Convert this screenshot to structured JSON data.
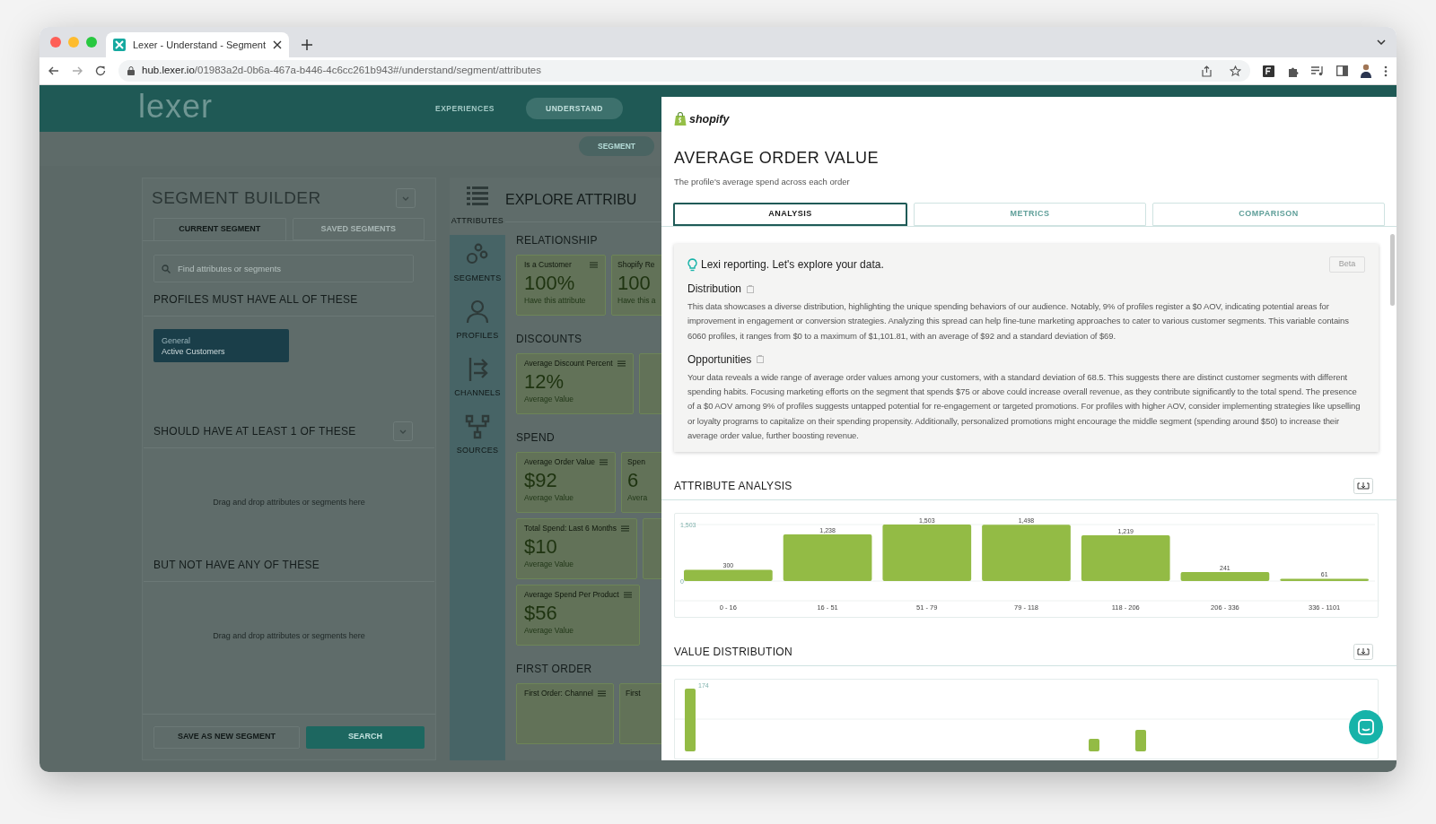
{
  "browser": {
    "tab_title": "Lexer - Understand - Segment",
    "url_host": "hub.lexer.io",
    "url_path": "/01983a2d-0b6a-467a-b446-4c6cc261b943#/understand/segment/attributes"
  },
  "app_header": {
    "logo": "lexer",
    "nav": [
      {
        "label": "EXPERIENCES",
        "selected": false
      },
      {
        "label": "UNDERSTAND",
        "selected": true
      }
    ],
    "subnav": [
      {
        "label": "SEGMENT",
        "selected": true
      }
    ]
  },
  "segment_builder": {
    "title": "SEGMENT BUILDER",
    "tabs": [
      {
        "label": "CURRENT SEGMENT",
        "selected": true
      },
      {
        "label": "SAVED SEGMENTS",
        "selected": false
      }
    ],
    "search": {
      "placeholder": "Find attributes or segments"
    },
    "sections": [
      {
        "title": "PROFILES MUST HAVE ALL OF THESE",
        "dropdown": false,
        "chips": [
          {
            "category": "General",
            "name": "Active Customers"
          }
        ]
      },
      {
        "title": "SHOULD HAVE AT LEAST 1 OF THESE",
        "dropdown": true,
        "hint": "Drag and drop attributes or segments here"
      },
      {
        "title": "BUT NOT HAVE ANY OF THESE",
        "dropdown": false,
        "hint": "Drag and drop attributes or segments here"
      }
    ],
    "buttons": [
      {
        "label": "SAVE AS NEW SEGMENT",
        "kind": "outline"
      },
      {
        "label": "SEARCH",
        "kind": "primary"
      }
    ]
  },
  "explore_nav": [
    {
      "label": "ATTRIBUTES",
      "kind": "list",
      "selected": true
    },
    {
      "label": "SEGMENTS",
      "kind": "circles",
      "selected": false
    },
    {
      "label": "PROFILES",
      "kind": "person",
      "selected": false
    },
    {
      "label": "CHANNELS",
      "kind": "arrows",
      "selected": false
    },
    {
      "label": "SOURCES",
      "kind": "network",
      "selected": false
    }
  ],
  "explore": {
    "title": "EXPLORE ATTRIBU",
    "groups": [
      {
        "title": "RELATIONSHIP",
        "rows": [
          [
            {
              "title": "Is a Customer",
              "value": "100%",
              "caption": "Have this attribute"
            },
            {
              "title": "Shopify Re",
              "value": "100",
              "caption": "Have this a"
            }
          ]
        ]
      },
      {
        "title": "DISCOUNTS",
        "rows": [
          [
            {
              "title": "Average Discount Percent",
              "value": "12%",
              "caption": "Average Value"
            },
            {}
          ]
        ]
      },
      {
        "title": "SPEND",
        "rows": [
          [
            {
              "title": "Average Order Value",
              "value": "$92",
              "caption": "Average Value"
            },
            {
              "title": "Spen",
              "value": "6",
              "caption": "Avera"
            }
          ],
          [
            {
              "title": "Total Spend: Last 6 Months",
              "value": "$10",
              "caption": "Average Value"
            },
            {}
          ],
          [
            {
              "title": "Average Spend Per Product",
              "value": "$56",
              "caption": "Average Value"
            }
          ]
        ]
      },
      {
        "title": "FIRST ORDER",
        "rows": [
          [
            {
              "title": "First Order: Channel"
            },
            {
              "title": "First"
            }
          ]
        ]
      }
    ]
  },
  "detail": {
    "source": "shopify",
    "title": "AVERAGE ORDER VALUE",
    "subtitle": "The profile's average spend across each order",
    "tabs": [
      {
        "label": "ANALYSIS",
        "selected": true
      },
      {
        "label": "METRICS",
        "selected": false
      },
      {
        "label": "COMPARISON",
        "selected": false
      }
    ],
    "lexi": {
      "heading": "Lexi reporting. Let's explore your data.",
      "badge": "Beta",
      "sections": [
        {
          "title": "Distribution",
          "text": "This data showcases a diverse distribution, highlighting the unique spending behaviors of our audience. Notably, 9% of profiles register a $0 AOV, indicating potential areas for improvement in engagement or conversion strategies. Analyzing this spread can help fine-tune marketing approaches to cater to various customer segments. This variable contains 6060 profiles, it ranges from $0 to a maximum of $1,101.81, with an average of $92 and a standard deviation of $69."
        },
        {
          "title": "Opportunities",
          "text": "Your data reveals a wide range of average order values among your customers, with a standard deviation of 68.5. This suggests there are distinct customer segments with different spending habits. Focusing marketing efforts on the segment that spends $75 or above could increase overall revenue, as they contribute significantly to the total spend. The presence of a $0 AOV among 9% of profiles suggests untapped potential for re-engagement or targeted promotions. For profiles with higher AOV, consider implementing strategies like upselling or loyalty programs to capitalize on their spending propensity. Additionally, personalized promotions might encourage the middle segment (spending around $50) to increase their average order value, further boosting revenue."
        }
      ]
    },
    "attribute_analysis": {
      "title": "ATTRIBUTE ANALYSIS",
      "chart_data": {
        "type": "bar",
        "categories": [
          "0 - 16",
          "16 - 51",
          "51 - 79",
          "79 - 118",
          "118 - 206",
          "206 - 336",
          "336 - 1101"
        ],
        "values": [
          300,
          1238,
          1503,
          1498,
          1219,
          241,
          61
        ],
        "value_labels": [
          "300",
          "1,238",
          "1,503",
          "1,498",
          "1,219",
          "241",
          "61"
        ],
        "ylim": [
          0,
          1503
        ],
        "yticks": [
          0,
          {
            "value": 1503,
            "label": "1,503"
          }
        ]
      }
    },
    "value_distribution": {
      "title": "VALUE DISTRIBUTION",
      "tick": "174"
    }
  }
}
